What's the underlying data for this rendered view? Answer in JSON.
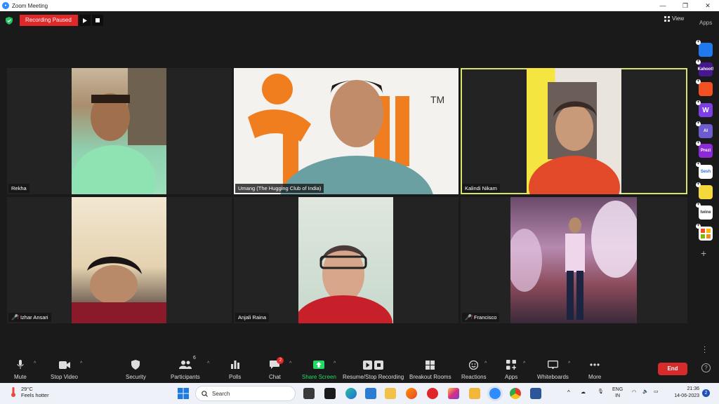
{
  "window": {
    "title": "Zoom Meeting",
    "minimize": "—",
    "restore": "❐",
    "close": "✕"
  },
  "recording": {
    "status": "Recording Paused"
  },
  "header": {
    "view_label": "View",
    "apps_label": "Apps"
  },
  "participants": [
    {
      "name": "Rekha",
      "muted": false,
      "active": false
    },
    {
      "name": "Umang (The Hugging Club of India)",
      "muted": false,
      "active": false
    },
    {
      "name": "Kalindi Nikam",
      "muted": false,
      "active": true
    },
    {
      "name": "Izhar Ansari",
      "muted": true,
      "active": false
    },
    {
      "name": "Anjali Raina",
      "muted": false,
      "active": false
    },
    {
      "name": "Francisco",
      "muted": true,
      "active": false
    }
  ],
  "side_apps": [
    {
      "label": "",
      "color": "#1f7af0"
    },
    {
      "label": "Kahoot!",
      "color": "#46178f"
    },
    {
      "label": "",
      "color": "#f25022"
    },
    {
      "label": "W",
      "color": "#7b3fe4"
    },
    {
      "label": "AI",
      "color": "#6d5bd0"
    },
    {
      "label": "Prezi",
      "color": "#8c2ad8"
    },
    {
      "label": "Sesh",
      "color": "#ffffff"
    },
    {
      "label": "",
      "color": "#f5d93a"
    },
    {
      "label": "twine",
      "color": "#ffffff"
    },
    {
      "label": "",
      "color": "#ffffff"
    }
  ],
  "toolbar": {
    "mute": "Mute",
    "stop_video": "Stop Video",
    "security": "Security",
    "participants": "Participants",
    "participants_count": "6",
    "polls": "Polls",
    "chat": "Chat",
    "chat_badge": "2",
    "share_screen": "Share Screen",
    "recording": "Resume/Stop Recording",
    "breakout": "Breakout Rooms",
    "reactions": "Reactions",
    "apps": "Apps",
    "whiteboards": "Whiteboards",
    "more": "More",
    "end": "End",
    "help": "?"
  },
  "taskbar": {
    "temperature": "29°C",
    "weather_text": "Feels hotter",
    "search_placeholder": "Search",
    "lang_top": "ENG",
    "lang_bottom": "IN",
    "time": "21:36",
    "date": "14-06-2023",
    "notification_count": "2"
  },
  "colors": {
    "accent": "#2d8cff",
    "record_red": "#e02828",
    "active_speaker": "#d7e36a",
    "share_green": "#23d963"
  }
}
